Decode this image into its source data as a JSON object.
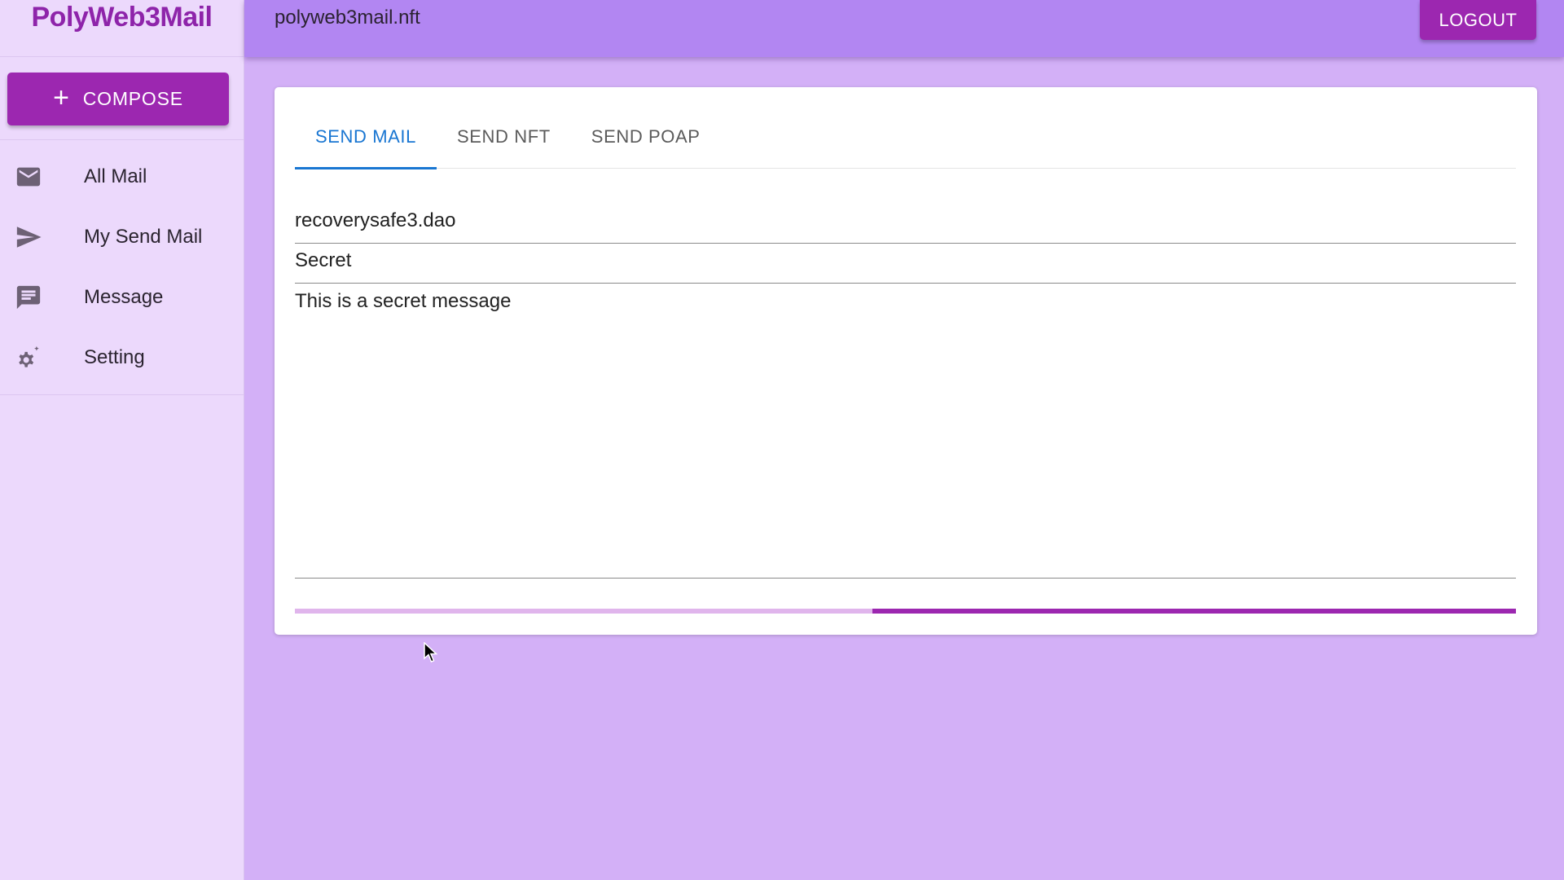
{
  "app": {
    "brand": "PolyWeb3Mail",
    "account": "polyweb3mail.nft"
  },
  "sidebar": {
    "compose_label": "COMPOSE",
    "items": [
      {
        "label": "All Mail",
        "icon": "mail-icon"
      },
      {
        "label": "My Send Mail",
        "icon": "send-icon"
      },
      {
        "label": "Message",
        "icon": "message-icon"
      },
      {
        "label": "Setting",
        "icon": "settings-icon"
      }
    ]
  },
  "header": {
    "logout_label": "LOGOUT"
  },
  "main": {
    "tabs": [
      {
        "label": "SEND MAIL",
        "active": true
      },
      {
        "label": "SEND NFT",
        "active": false
      },
      {
        "label": "SEND POAP",
        "active": false
      }
    ],
    "form": {
      "to": "recoverysafe3.dao",
      "subject": "Secret",
      "body": "This is a secret message"
    },
    "progress": {
      "indeterminate": true,
      "filled_fraction": 0.527
    }
  },
  "colors": {
    "accent": "#9c27b0",
    "topbar": "#b286f2",
    "background": "#d3b0f7",
    "sidebar": "#ecd9fc",
    "tab_active": "#1976d2"
  }
}
